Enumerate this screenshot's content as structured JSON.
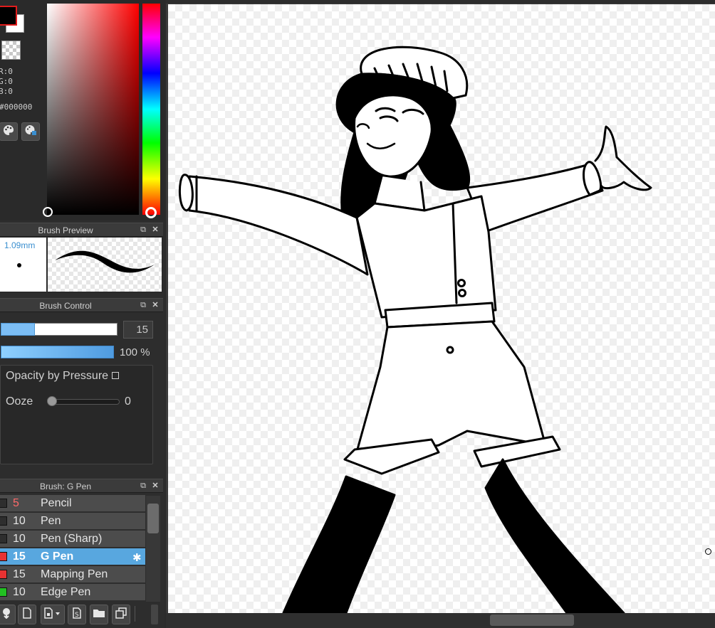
{
  "color": {
    "r_label": "R:0",
    "g_label": "G:0",
    "b_label": "B:0",
    "hex": "#000000",
    "main_color": "#000000",
    "sub_color": "#ffffff"
  },
  "brush_preview": {
    "title": "Brush Preview",
    "size": "1.09mm"
  },
  "brush_control": {
    "title": "Brush Control",
    "size_value": "15",
    "size_fraction": 0.29,
    "opacity_value": "100 %",
    "opacity_fraction": 1.0,
    "opacity_by_pressure_label": "Opacity by Pressure",
    "opacity_by_pressure_checked": false,
    "ooze_label": "Ooze",
    "ooze_value": "0"
  },
  "brush_list": {
    "title": "Brush: G Pen",
    "items": [
      {
        "size": "5",
        "name": "Pencil",
        "color": "#2e2e2e",
        "size_color": "#ff6a6a"
      },
      {
        "size": "10",
        "name": "Pen",
        "color": "#2e2e2e"
      },
      {
        "size": "10",
        "name": "Pen (Sharp)",
        "color": "#2e2e2e"
      },
      {
        "size": "15",
        "name": "G Pen",
        "color": "#e83232",
        "selected": true
      },
      {
        "size": "15",
        "name": "Mapping Pen",
        "color": "#e83232"
      },
      {
        "size": "10",
        "name": "Edge Pen",
        "color": "#22c022"
      }
    ]
  },
  "icons": {
    "palette": "palette-icon",
    "palette_edit": "palette-edit-icon",
    "popout": "popout-icon",
    "close": "close-icon",
    "settings": "gear-icon",
    "toolbar": [
      "import-brush-icon",
      "new-brush-icon",
      "brush-menu-icon",
      "script-brush-icon",
      "folder-icon",
      "duplicate-icon"
    ]
  }
}
